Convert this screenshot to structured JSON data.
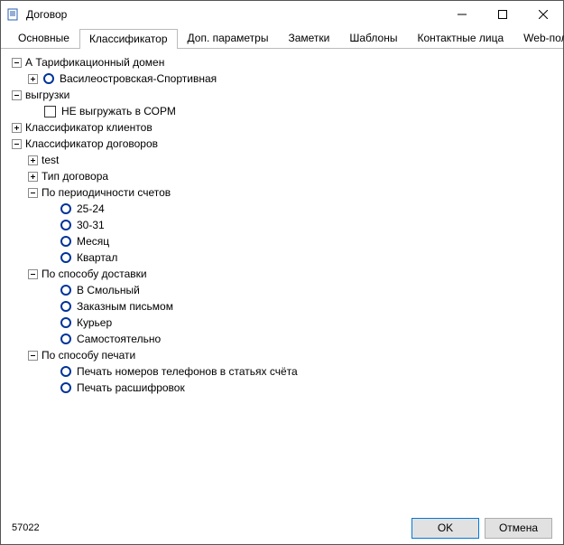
{
  "window": {
    "title": "Договор"
  },
  "tabs": [
    "Основные",
    "Классификатор",
    "Доп. параметры",
    "Заметки",
    "Шаблоны",
    "Контактные лица",
    "Web-пользоват"
  ],
  "tree": {
    "tarif": {
      "label": "А Тарификационный домен",
      "items": [
        "Василеостровская-Спортивная"
      ]
    },
    "exports": {
      "label": "выгрузки",
      "items": [
        "НЕ выгружать в СОРМ"
      ]
    },
    "clients": {
      "label": "Классификатор клиентов"
    },
    "contracts": {
      "label": "Классификатор договоров",
      "items": [
        "test",
        "Тип договора"
      ],
      "periodicity": {
        "label": "По периодичности счетов",
        "items": [
          "25-24",
          "30-31",
          "Месяц",
          "Квартал"
        ]
      },
      "delivery": {
        "label": "По способу доставки",
        "items": [
          "В Смольный",
          "Заказным письмом",
          "Курьер",
          "Самостоятельно"
        ]
      },
      "print": {
        "label": "По способу печати",
        "items": [
          "Печать номеров телефонов в статьях счёта",
          "Печать расшифровок"
        ]
      }
    }
  },
  "footer": {
    "id": "57022",
    "ok": "OK",
    "cancel": "Отмена"
  }
}
